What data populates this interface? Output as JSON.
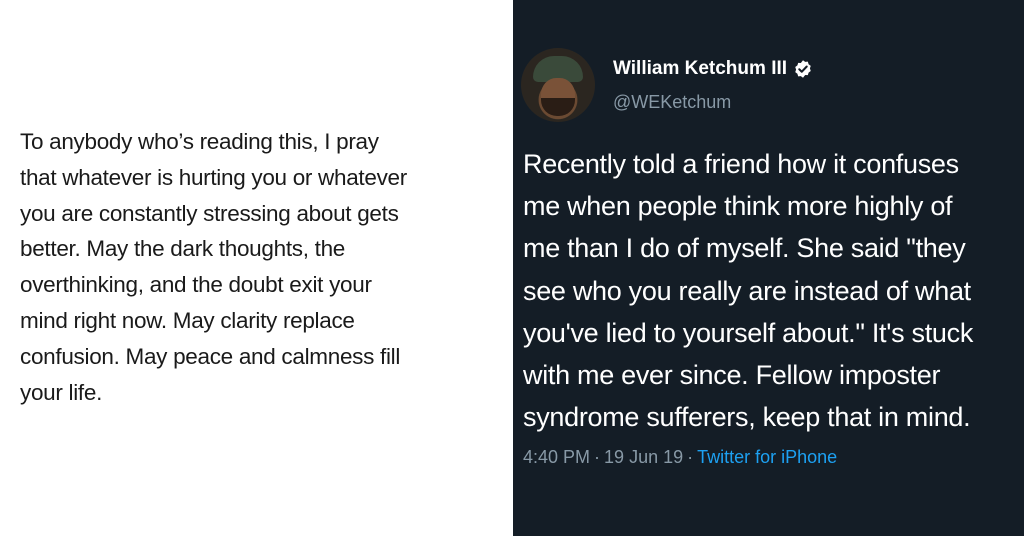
{
  "left_post": {
    "text": "To anybody who’s reading this, I pray\nthat whatever is hurting you or whatever\nyou are constantly stressing about gets\nbetter. May the dark thoughts, the\noverthinking, and the doubt exit your\nmind right now. May clarity replace\nconfusion. May peace and calmness fill\nyour life."
  },
  "tweet": {
    "user_name": "William Ketchum III",
    "handle": "@WEKetchum",
    "verified_icon": "verified-badge-icon",
    "text": "Recently told a friend how it confuses\nme when people think more highly of\nme than I do of myself. She said \"they\nsee who you really are instead of what\nyou've lied to yourself about.\" It's stuck\nwith me ever since. Fellow imposter\nsyndrome sufferers, keep that in mind.",
    "time": "4:40 PM",
    "date": "19 Jun 19",
    "separator": "·",
    "source": "Twitter for iPhone"
  },
  "colors": {
    "left_background": "#ffffff",
    "right_background": "#141d26",
    "link": "#1da1f2",
    "muted": "#8899a6"
  }
}
